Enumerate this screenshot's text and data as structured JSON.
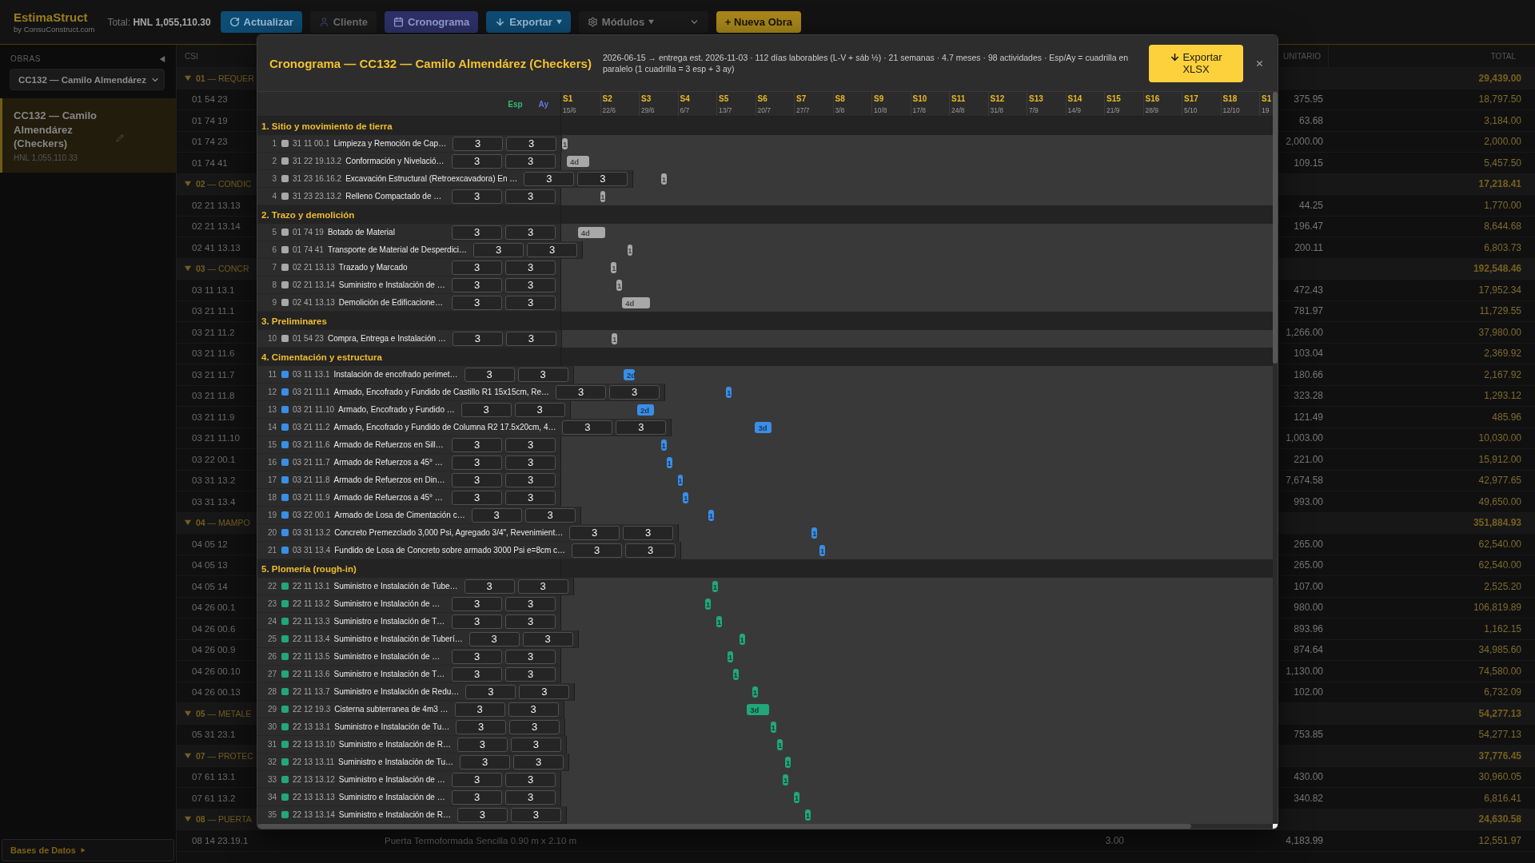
{
  "app": {
    "name": "EstimaStruct",
    "tagline": "by ConsuConstruct.com",
    "total": "Total: **HNL 1,055,110.30**"
  },
  "toolbar": [
    {
      "kind": "refresh",
      "label": "Actualizar"
    },
    {
      "kind": "client",
      "label": "Cliente"
    },
    {
      "kind": "schedule",
      "label": "Cronograma"
    },
    {
      "kind": "export",
      "label": "Exportar"
    },
    {
      "kind": "modules",
      "label": "Módulos"
    },
    {
      "kind": "new",
      "label": "+ Nueva Obra"
    }
  ],
  "sidebar": {
    "heading": "OBRAS",
    "project_select": {
      "value": "CC132 — Camilo Almendárez"
    },
    "projects": [
      {
        "name": "CC132 — Camilo Almendárez (Checkers)",
        "total": "HNL 1,055,110.33",
        "selected": true
      }
    ],
    "footer_link": "Bases de Datos"
  },
  "budget_table": {
    "columns": [
      {
        "kind": "csi",
        "label": "CSI"
      },
      {
        "kind": "unit_price",
        "label": "UNITARIO"
      },
      {
        "kind": "total",
        "label": "TOTAL"
      }
    ],
    "rows": [
      {
        "kind": "group",
        "label": "**01** — REQUER",
        "total": "29,439.00",
        "expanded": true
      },
      {
        "kind": "item",
        "csi": "01 54 23",
        "unit_price": "375.95",
        "total": "18,797.50"
      },
      {
        "kind": "item",
        "csi": "01 74 19",
        "unit_price": "63.68",
        "total": "3,184.00"
      },
      {
        "kind": "item",
        "csi": "01 74 23",
        "unit_price": "2,000.00",
        "total": "2,000.00"
      },
      {
        "kind": "item",
        "csi": "01 74 41",
        "unit_price": "109.15",
        "total": "5,457.50"
      },
      {
        "kind": "group",
        "label": "**02** — CONDIC",
        "total": "17,218.41",
        "expanded": true
      },
      {
        "kind": "item",
        "csi": "02 21 13.13",
        "unit_price": "44.25",
        "total": "1,770.00"
      },
      {
        "kind": "item",
        "csi": "02 21 13.14",
        "unit_price": "196.47",
        "total": "8,644.68"
      },
      {
        "kind": "item",
        "csi": "02 41 13.13",
        "unit_price": "200.11",
        "total": "6,803.73"
      },
      {
        "kind": "group",
        "label": "**03** — CONCR",
        "total": "192,548.46",
        "expanded": true
      },
      {
        "kind": "item",
        "csi": "03 11 13.1",
        "unit_price": "472.43",
        "total": "17,952.34"
      },
      {
        "kind": "item",
        "csi": "03 21 11.1",
        "unit_price": "781.97",
        "total": "11,729.55"
      },
      {
        "kind": "item",
        "csi": "03 21 11.2",
        "unit_price": "1,266.00",
        "total": "37,980.00"
      },
      {
        "kind": "item",
        "csi": "03 21 11.6",
        "unit_price": "103.04",
        "total": "2,369.92"
      },
      {
        "kind": "item",
        "csi": "03 21 11.7",
        "unit_price": "180.66",
        "total": "2,167.92"
      },
      {
        "kind": "item",
        "csi": "03 21 11.8",
        "unit_price": "323.28",
        "total": "1,293.12"
      },
      {
        "kind": "item",
        "csi": "03 21 11.9",
        "unit_price": "121.49",
        "total": "485.96"
      },
      {
        "kind": "item",
        "csi": "03 21 11.10",
        "unit_price": "1,003.00",
        "total": "10,030.00"
      },
      {
        "kind": "item",
        "csi": "03 22 00.1",
        "unit_price": "221.00",
        "total": "15,912.00"
      },
      {
        "kind": "item",
        "csi": "03 31 13.2",
        "unit_price": "7,674.58",
        "total": "42,977.65"
      },
      {
        "kind": "item",
        "csi": "03 31 13.4",
        "unit_price": "993.00",
        "total": "49,650.00"
      },
      {
        "kind": "group",
        "label": "**04** — MAMPO",
        "total": "351,884.93",
        "expanded": true
      },
      {
        "kind": "item",
        "csi": "04 05 12",
        "unit_price": "265.00",
        "total": "62,540.00"
      },
      {
        "kind": "item",
        "csi": "04 05 13",
        "unit_price": "265.00",
        "total": "62,540.00"
      },
      {
        "kind": "item",
        "csi": "04 05 14",
        "unit_price": "107.00",
        "total": "2,525.20"
      },
      {
        "kind": "item",
        "csi": "04 26 00.1",
        "unit_price": "980.00",
        "total": "106,819.89"
      },
      {
        "kind": "item",
        "csi": "04 26 00.6",
        "unit_price": "893.96",
        "total": "1,162.15"
      },
      {
        "kind": "item",
        "csi": "04 26 00.9",
        "unit_price": "874.64",
        "total": "34,985.60"
      },
      {
        "kind": "item",
        "csi": "04 26 00.10",
        "unit_price": "1,130.00",
        "total": "74,580.00"
      },
      {
        "kind": "item",
        "csi": "04 26 00.13",
        "unit_price": "102.00",
        "total": "6,732.09"
      },
      {
        "kind": "group",
        "label": "**05** — METALE",
        "total": "54,277.13",
        "expanded": true
      },
      {
        "kind": "item",
        "csi": "05 31 23.1",
        "unit_price": "753.85",
        "total": "54,277.13"
      },
      {
        "kind": "group",
        "label": "**07** — PROTEC",
        "total": "37,776.45",
        "expanded": true
      },
      {
        "kind": "item",
        "csi": "07 61 13.1",
        "unit_price": "430.00",
        "total": "30,960.05"
      },
      {
        "kind": "item",
        "csi": "07 61 13.2",
        "unit_price": "340.82",
        "total": "6,816.41"
      },
      {
        "kind": "group",
        "label": "**08** — PUERTA",
        "total": "24,630.58",
        "expanded": true
      },
      {
        "kind": "item",
        "csi": "08 14 23.19.1",
        "description": "Puerta Termoformada Sencilla 0.90 m x 2.10 m",
        "quantity": "3.00",
        "unit_price": "4,183.99",
        "total": "12,551.97"
      }
    ]
  },
  "schedule_dialog": {
    "title": "Cronograma — CC132 — Camilo Almendárez (Checkers)",
    "summary": "2026-06-15 → entrega est. 2026-11-03 · 112 días laborables (L-V + sáb ½) · 21 semanas · 4.7 meses · 98 actividades · Esp/Ay = cuadrilla en paralelo (1 cuadrilla = 3 esp + 3 ay)",
    "export_button": "Exportar XLSX",
    "crew_columns": [
      {
        "kind": "esp",
        "label": "Esp"
      },
      {
        "kind": "ay",
        "label": "Ay"
      }
    ],
    "weeks": [
      {
        "label": "S1",
        "date": "15/6"
      },
      {
        "label": "S2",
        "date": "22/6"
      },
      {
        "label": "S3",
        "date": "29/6"
      },
      {
        "label": "S4",
        "date": "6/7"
      },
      {
        "label": "S5",
        "date": "13/7"
      },
      {
        "label": "S6",
        "date": "20/7"
      },
      {
        "label": "S7",
        "date": "27/7"
      },
      {
        "label": "S8",
        "date": "3/8"
      },
      {
        "label": "S9",
        "date": "10/8"
      },
      {
        "label": "S10",
        "date": "17/8"
      },
      {
        "label": "S11",
        "date": "24/8"
      },
      {
        "label": "S12",
        "date": "31/8"
      },
      {
        "label": "S13",
        "date": "7/9"
      },
      {
        "label": "S14",
        "date": "14/9"
      },
      {
        "label": "S15",
        "date": "21/9"
      },
      {
        "label": "S16",
        "date": "28/9"
      },
      {
        "label": "S17",
        "date": "5/10"
      },
      {
        "label": "S18",
        "date": "12/10"
      },
      {
        "label": "S1",
        "date": "19"
      }
    ],
    "sections": [
      {
        "title": "1. Sitio y movimiento de tierra",
        "activities": [
          {
            "number": "1",
            "csi": "31 11 00.1",
            "name": "Limpieza y Remoción de Cap…",
            "color": "#a8a8a8",
            "esp": "3",
            "ay": "3",
            "bar": {
              "label": "1"
            }
          },
          {
            "number": "2",
            "csi": "31 22 19.13.2",
            "name": "Conformación y Nivelació…",
            "color": "#a8a8a8",
            "esp": "3",
            "ay": "3",
            "bar": {
              "label": "4d"
            }
          },
          {
            "number": "3",
            "csi": "31 23 16.16.2",
            "name": "Excavación Estructural (Retroexcavadora) En …",
            "color": "#a8a8a8",
            "esp": "3",
            "ay": "3",
            "bar": {
              "label": "1"
            }
          },
          {
            "number": "4",
            "csi": "31 23 23.13.2",
            "name": "Relleno Compactado de …",
            "color": "#a8a8a8",
            "esp": "3",
            "ay": "3",
            "bar": {
              "label": "1"
            }
          }
        ]
      },
      {
        "title": "2. Trazo y demolición",
        "activities": [
          {
            "number": "5",
            "csi": "01 74 19",
            "name": "Botado de Material",
            "color": "#a8a8a8",
            "esp": "3",
            "ay": "3",
            "bar": {
              "label": "4d"
            }
          },
          {
            "number": "6",
            "csi": "01 74 41",
            "name": "Transporte de Material de Desperdici…",
            "color": "#a8a8a8",
            "esp": "3",
            "ay": "3",
            "bar": {
              "label": "1"
            }
          },
          {
            "number": "7",
            "csi": "02 21 13.13",
            "name": "Trazado y Marcado",
            "color": "#a8a8a8",
            "esp": "3",
            "ay": "3",
            "bar": {
              "label": "1"
            }
          },
          {
            "number": "8",
            "csi": "02 21 13.14",
            "name": "Suministro e Instalación de …",
            "color": "#a8a8a8",
            "esp": "3",
            "ay": "3",
            "bar": {
              "label": "1"
            }
          },
          {
            "number": "9",
            "csi": "02 41 13.13",
            "name": "Demolición de Edificacione…",
            "color": "#a8a8a8",
            "esp": "3",
            "ay": "3",
            "bar": {
              "label": "4d"
            }
          }
        ]
      },
      {
        "title": "3. Preliminares",
        "activities": [
          {
            "number": "10",
            "csi": "01 54 23",
            "name": "Compra, Entrega e Instalación …",
            "color": "#a8a8a8",
            "esp": "3",
            "ay": "3",
            "bar": {
              "label": "1"
            }
          }
        ]
      },
      {
        "title": "4. Cimentación y estructura",
        "activities": [
          {
            "number": "11",
            "csi": "03 11 13.1",
            "name": "Instalación de encofrado perimet…",
            "color": "#3a8ee6",
            "esp": "3",
            "ay": "3",
            "bar": {
              "label": "2d"
            }
          },
          {
            "number": "12",
            "csi": "03 21 11.1",
            "name": "Armado, Encofrado y Fundido de Castillo R1 15x15cm, Re…",
            "color": "#3a8ee6",
            "esp": "3",
            "ay": "3",
            "bar": {
              "label": "1"
            }
          },
          {
            "number": "13",
            "csi": "03 21 11.10",
            "name": "Armado, Encofrado y Fundido …",
            "color": "#3a8ee6",
            "esp": "3",
            "ay": "3",
            "bar": {
              "label": "2d"
            }
          },
          {
            "number": "14",
            "csi": "03 21 11.2",
            "name": "Armado, Encofrado y Fundido de Columna R2 17.5x20cm, 4…",
            "color": "#3a8ee6",
            "esp": "3",
            "ay": "3",
            "bar": {
              "label": "3d"
            }
          },
          {
            "number": "15",
            "csi": "03 21 11.6",
            "name": "Armado de Refuerzos en Sill…",
            "color": "#3a8ee6",
            "esp": "3",
            "ay": "3",
            "bar": {
              "label": "1"
            }
          },
          {
            "number": "16",
            "csi": "03 21 11.7",
            "name": "Armado de Refuerzos a 45° …",
            "color": "#3a8ee6",
            "esp": "3",
            "ay": "3",
            "bar": {
              "label": "1"
            }
          },
          {
            "number": "17",
            "csi": "03 21 11.8",
            "name": "Armado de Refuerzos en Din…",
            "color": "#3a8ee6",
            "esp": "3",
            "ay": "3",
            "bar": {
              "label": "1"
            }
          },
          {
            "number": "18",
            "csi": "03 21 11.9",
            "name": "Armado de Refuerzos a 45° …",
            "color": "#3a8ee6",
            "esp": "3",
            "ay": "3",
            "bar": {
              "label": "1"
            }
          },
          {
            "number": "19",
            "csi": "03 22 00.1",
            "name": "Armado de Losa de Cimentación c…",
            "color": "#3a8ee6",
            "esp": "3",
            "ay": "3",
            "bar": {
              "label": "1"
            }
          },
          {
            "number": "20",
            "csi": "03 31 13.2",
            "name": "Concreto Premezclado 3,000 Psi, Agregado 3/4\", Revenimient…",
            "color": "#3a8ee6",
            "esp": "3",
            "ay": "3",
            "bar": {
              "label": "1"
            }
          },
          {
            "number": "21",
            "csi": "03 31 13.4",
            "name": "Fundido de Losa de Concreto sobre armado 3000 Psi e=8cm c…",
            "color": "#3a8ee6",
            "esp": "3",
            "ay": "3",
            "bar": {
              "label": "1"
            }
          }
        ]
      },
      {
        "title": "5. Plomería (rough-in)",
        "activities": [
          {
            "number": "22",
            "csi": "22 11 13.1",
            "name": "Suministro e Instalación de Tube…",
            "color": "#23a679",
            "esp": "3",
            "ay": "3",
            "bar": {
              "label": "1"
            }
          },
          {
            "number": "23",
            "csi": "22 11 13.2",
            "name": "Suministro e Instalación de …",
            "color": "#23a679",
            "esp": "3",
            "ay": "3",
            "bar": {
              "label": "1"
            }
          },
          {
            "number": "24",
            "csi": "22 11 13.3",
            "name": "Suministro e Instalación de T…",
            "color": "#23a679",
            "esp": "3",
            "ay": "3",
            "bar": {
              "label": "1"
            }
          },
          {
            "number": "25",
            "csi": "22 11 13.4",
            "name": "Suministro e Instalación de Tuberí…",
            "color": "#23a679",
            "esp": "3",
            "ay": "3",
            "bar": {
              "label": "1"
            }
          },
          {
            "number": "26",
            "csi": "22 11 13.5",
            "name": "Suministro e Instalación de …",
            "color": "#23a679",
            "esp": "3",
            "ay": "3",
            "bar": {
              "label": "1"
            }
          },
          {
            "number": "27",
            "csi": "22 11 13.6",
            "name": "Suministro e Instalación de T…",
            "color": "#23a679",
            "esp": "3",
            "ay": "3",
            "bar": {
              "label": "1"
            }
          },
          {
            "number": "28",
            "csi": "22 11 13.7",
            "name": "Suministro e Instalación de Redu…",
            "color": "#23a679",
            "esp": "3",
            "ay": "3",
            "bar": {
              "label": "1"
            }
          },
          {
            "number": "29",
            "csi": "22 12 19.3",
            "name": "Cisterna subterranea de 4m3 …",
            "color": "#23a679",
            "esp": "3",
            "ay": "3",
            "bar": {
              "label": "3d"
            }
          },
          {
            "number": "30",
            "csi": "22 13 13.1",
            "name": "Suministro e Instalación de Tu…",
            "color": "#23a679",
            "esp": "3",
            "ay": "3",
            "bar": {
              "label": "1"
            }
          },
          {
            "number": "31",
            "csi": "22 13 13.10",
            "name": "Suministro e Instalación de R…",
            "color": "#23a679",
            "esp": "3",
            "ay": "3",
            "bar": {
              "label": "1"
            }
          },
          {
            "number": "32",
            "csi": "22 13 13.11",
            "name": "Suministro e Instalación de Tu…",
            "color": "#23a679",
            "esp": "3",
            "ay": "3",
            "bar": {
              "label": "1"
            }
          },
          {
            "number": "33",
            "csi": "22 13 13.12",
            "name": "Suministro e Instalación de …",
            "color": "#23a679",
            "esp": "3",
            "ay": "3",
            "bar": {
              "label": "1"
            }
          },
          {
            "number": "34",
            "csi": "22 13 13.13",
            "name": "Suministro e Instalación de …",
            "color": "#23a679",
            "esp": "3",
            "ay": "3",
            "bar": {
              "label": "1"
            }
          },
          {
            "number": "35",
            "csi": "22 13 13.14",
            "name": "Suministro e Instalación de R…",
            "color": "#23a679",
            "esp": "3",
            "ay": "3",
            "bar": {
              "label": "1"
            }
          }
        ]
      }
    ]
  }
}
